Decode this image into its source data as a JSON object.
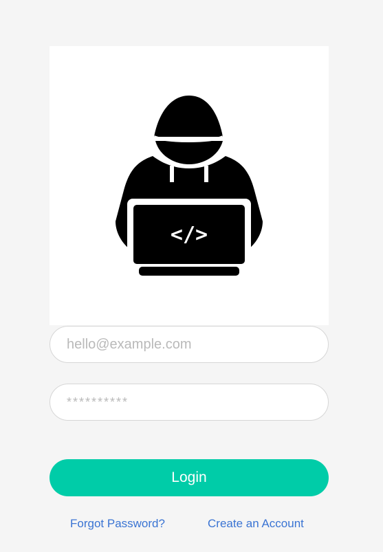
{
  "hero": {
    "icon": "hacker-with-laptop-icon",
    "code_glyph": "</>"
  },
  "login_form": {
    "email_placeholder": "hello@example.com",
    "password_placeholder": "**********",
    "login_label": "Login",
    "forgot_password_label": "Forgot Password?",
    "create_account_label": "Create an Account"
  },
  "colors": {
    "background": "#f5f5f5",
    "card": "#ffffff",
    "accent": "#00cca8",
    "link": "#3a74d3",
    "field_border": "#d6d6d6",
    "placeholder": "#b9b9b9"
  }
}
